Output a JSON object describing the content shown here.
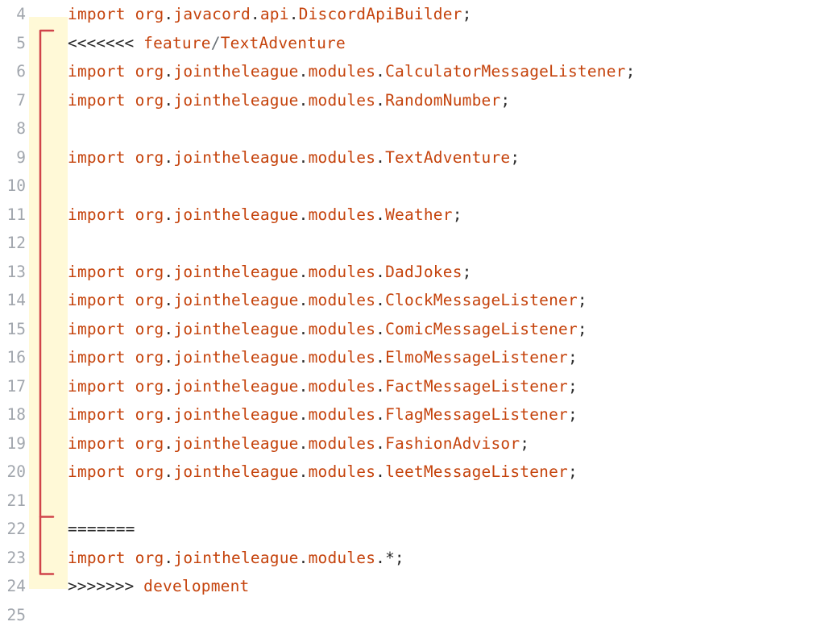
{
  "lines": {
    "4": {
      "n": "4",
      "type": "import",
      "segments": [
        "org",
        "javacord",
        "api"
      ],
      "cls": "DiscordApiBuilder"
    },
    "5": {
      "n": "5",
      "type": "conflict-start",
      "marker": "<<<<<<<",
      "branchLeft": "feature",
      "branchRight": "TextAdventure"
    },
    "6": {
      "n": "6",
      "type": "import",
      "segments": [
        "org",
        "jointheleague",
        "modules"
      ],
      "cls": "CalculatorMessageListener"
    },
    "7": {
      "n": "7",
      "type": "import",
      "segments": [
        "org",
        "jointheleague",
        "modules"
      ],
      "cls": "RandomNumber"
    },
    "8": {
      "n": "8",
      "type": "blank"
    },
    "9": {
      "n": "9",
      "type": "import",
      "segments": [
        "org",
        "jointheleague",
        "modules"
      ],
      "cls": "TextAdventure"
    },
    "10": {
      "n": "10",
      "type": "blank"
    },
    "11": {
      "n": "11",
      "type": "import",
      "segments": [
        "org",
        "jointheleague",
        "modules"
      ],
      "cls": "Weather"
    },
    "12": {
      "n": "12",
      "type": "blank"
    },
    "13": {
      "n": "13",
      "type": "import",
      "segments": [
        "org",
        "jointheleague",
        "modules"
      ],
      "cls": "DadJokes"
    },
    "14": {
      "n": "14",
      "type": "import",
      "segments": [
        "org",
        "jointheleague",
        "modules"
      ],
      "cls": "ClockMessageListener"
    },
    "15": {
      "n": "15",
      "type": "import",
      "segments": [
        "org",
        "jointheleague",
        "modules"
      ],
      "cls": "ComicMessageListener"
    },
    "16": {
      "n": "16",
      "type": "import",
      "segments": [
        "org",
        "jointheleague",
        "modules"
      ],
      "cls": "ElmoMessageListener"
    },
    "17": {
      "n": "17",
      "type": "import",
      "segments": [
        "org",
        "jointheleague",
        "modules"
      ],
      "cls": "FactMessageListener"
    },
    "18": {
      "n": "18",
      "type": "import",
      "segments": [
        "org",
        "jointheleague",
        "modules"
      ],
      "cls": "FlagMessageListener"
    },
    "19": {
      "n": "19",
      "type": "import",
      "segments": [
        "org",
        "jointheleague",
        "modules"
      ],
      "cls": "FashionAdvisor"
    },
    "20": {
      "n": "20",
      "type": "import",
      "segments": [
        "org",
        "jointheleague",
        "modules"
      ],
      "cls": "leetMessageListener"
    },
    "21": {
      "n": "21",
      "type": "blank"
    },
    "22": {
      "n": "22",
      "type": "conflict-sep",
      "marker": "======="
    },
    "23": {
      "n": "23",
      "type": "import-star",
      "segments": [
        "org",
        "jointheleague",
        "modules"
      ],
      "star": "*"
    },
    "24": {
      "n": "24",
      "type": "conflict-end",
      "marker": ">>>>>>>",
      "branch": "development"
    },
    "25": {
      "n": "25",
      "type": "blank"
    }
  },
  "importKeyword": "import",
  "order": [
    "4",
    "5",
    "6",
    "7",
    "8",
    "9",
    "10",
    "11",
    "12",
    "13",
    "14",
    "15",
    "16",
    "17",
    "18",
    "19",
    "20",
    "21",
    "22",
    "23",
    "24",
    "25"
  ],
  "conflictHighlight": {
    "from": "5",
    "to": "24"
  },
  "bracketColor": "#d0444a"
}
